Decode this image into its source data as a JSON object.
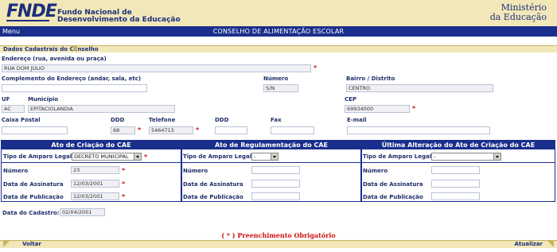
{
  "header": {
    "logo": "FNDE",
    "org_line1": "Fundo Nacional de",
    "org_line2": "Desenvolvimento da Educação",
    "ministry_line1": "Ministério",
    "ministry_line2": "da Educação"
  },
  "nav": {
    "menu": "Menu",
    "title": "CONSELHO DE ALIMENTAÇÃO ESCOLAR"
  },
  "section": {
    "title": "Dados Cadastrais do Conselho"
  },
  "address": {
    "endereco_label": "Endereço (rua, avenida ou praça)",
    "endereco_value": "RUA DOM JULIO",
    "complemento_label": "Complemento do Endereço (andar, sala, etc)",
    "complemento_value": "",
    "numero_label": "Número",
    "numero_value": "S/N",
    "bairro_label": "Bairro / Distrito",
    "bairro_value": "CENTRO",
    "uf_label": "UF",
    "uf_value": "AC",
    "municipio_label": "Município",
    "municipio_value": "EPITACIOLANDIA",
    "cep_label": "CEP",
    "cep_value": "69934000"
  },
  "contact": {
    "caixa_label": "Caixa Postal",
    "caixa_value": "",
    "ddd1_label": "DDD",
    "ddd1_value": "68",
    "telefone_label": "Telefone",
    "telefone_value": "5464715",
    "ddd2_label": "DDD",
    "ddd2_value": "",
    "fax_label": "Fax",
    "fax_value": "",
    "email_label": "E-mail",
    "email_value": ""
  },
  "acts": {
    "col1_title": "Ato de Criação do CAE",
    "col2_title": "Ato de Regulamentação do CAE",
    "col3_title": "Última Alteração do Ato de Criação do CAE",
    "tipo_label": "Tipo de Amparo Legal",
    "numero_label": "Número",
    "assinatura_label": "Data de Assinatura",
    "publicacao_label": "Data de Publicação",
    "col1": {
      "tipo": "DECRETO MUNICIPAL",
      "numero": "23",
      "assinatura": "12/03/2001",
      "publicacao": "12/03/2001"
    },
    "col2": {
      "tipo": "-",
      "numero": "",
      "assinatura": "",
      "publicacao": ""
    },
    "col3": {
      "tipo": "-",
      "numero": "",
      "assinatura": "",
      "publicacao": ""
    }
  },
  "cadastro": {
    "label": "Data do Cadastro:",
    "value": "02/04/2001"
  },
  "required_note": {
    "star": "( * )",
    "text": "Preenchimento Obrigatório"
  },
  "footer": {
    "back": "Voltar",
    "update": "Atualizar"
  },
  "colors": {
    "navy": "#1a2f8c",
    "beige": "#f2e7b9",
    "required": "#cc1111"
  }
}
